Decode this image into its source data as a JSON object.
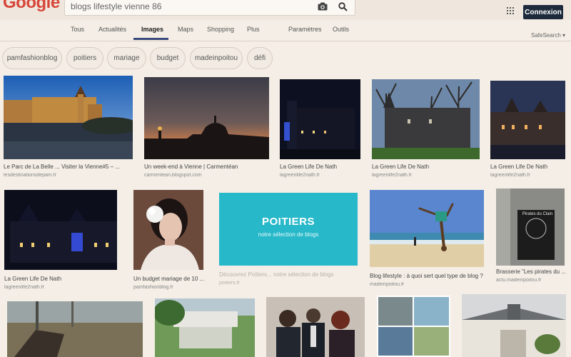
{
  "search": {
    "query": "blogs lifestyle vienne 86",
    "placeholder": ""
  },
  "logo": {
    "text": "Google"
  },
  "header": {
    "connexion_label": "Connexion"
  },
  "nav": {
    "tabs": [
      {
        "label": "Tous"
      },
      {
        "label": "Actualités"
      },
      {
        "label": "Images",
        "active": true
      },
      {
        "label": "Maps"
      },
      {
        "label": "Shopping"
      },
      {
        "label": "Plus"
      },
      {
        "label": "Paramètres"
      },
      {
        "label": "Outils"
      }
    ],
    "safesearch": "SafeSearch ▾"
  },
  "chips": [
    {
      "label": "pamfashionblog"
    },
    {
      "label": "poitiers"
    },
    {
      "label": "mariage"
    },
    {
      "label": "budget"
    },
    {
      "label": "madeinpoitou"
    },
    {
      "label": "défi"
    }
  ],
  "results": {
    "row1": [
      {
        "caption": "Le Parc de La Belle ... Visiter la Vienne#5 – ...",
        "source": "lesdestinationsdepam.fr"
      },
      {
        "caption": "Un week-end à Vienne | Carmentéan",
        "source": "carmentean.blogspot.com"
      },
      {
        "caption": "La Green Life De Nath",
        "source": "lagreenlife2nath.fr"
      },
      {
        "caption": "La Green Life De Nath",
        "source": "lagreenlife2nath.fr"
      },
      {
        "caption": "La Green Life De Nath",
        "source": "lagreenlife2nath.fr"
      }
    ],
    "row2": [
      {
        "caption": "La Green Life De Nath",
        "source": "lagreenlife2nath.fr"
      },
      {
        "caption": "Un budget mariage de 10 ...",
        "source": "pamfashionblog.fr"
      },
      {
        "caption": "Découvrez Poitiers... notre sélection de blogs",
        "source": "poitiers.fr",
        "title": "POITIERS",
        "subtitle": "notre sélection de blogs"
      },
      {
        "caption": "Blog lifestyle : à quoi sert quel type de blog ?",
        "source": "madeinpoitou.fr"
      },
      {
        "caption": "Brasserie \"Les pirates du ...",
        "source": "actu.madeinpoitou.fr",
        "sign": "Pirates du Clain"
      }
    ]
  },
  "colors": {
    "page_bg": "#f4eee6",
    "connexion_bg": "#1c2a3c",
    "active_tab_underline": "#3b4a7a",
    "poitiers_tile": "#27b8c9",
    "logo_red": "#d8463a"
  },
  "icons": [
    "camera-icon",
    "search-icon",
    "apps-grid-icon"
  ]
}
